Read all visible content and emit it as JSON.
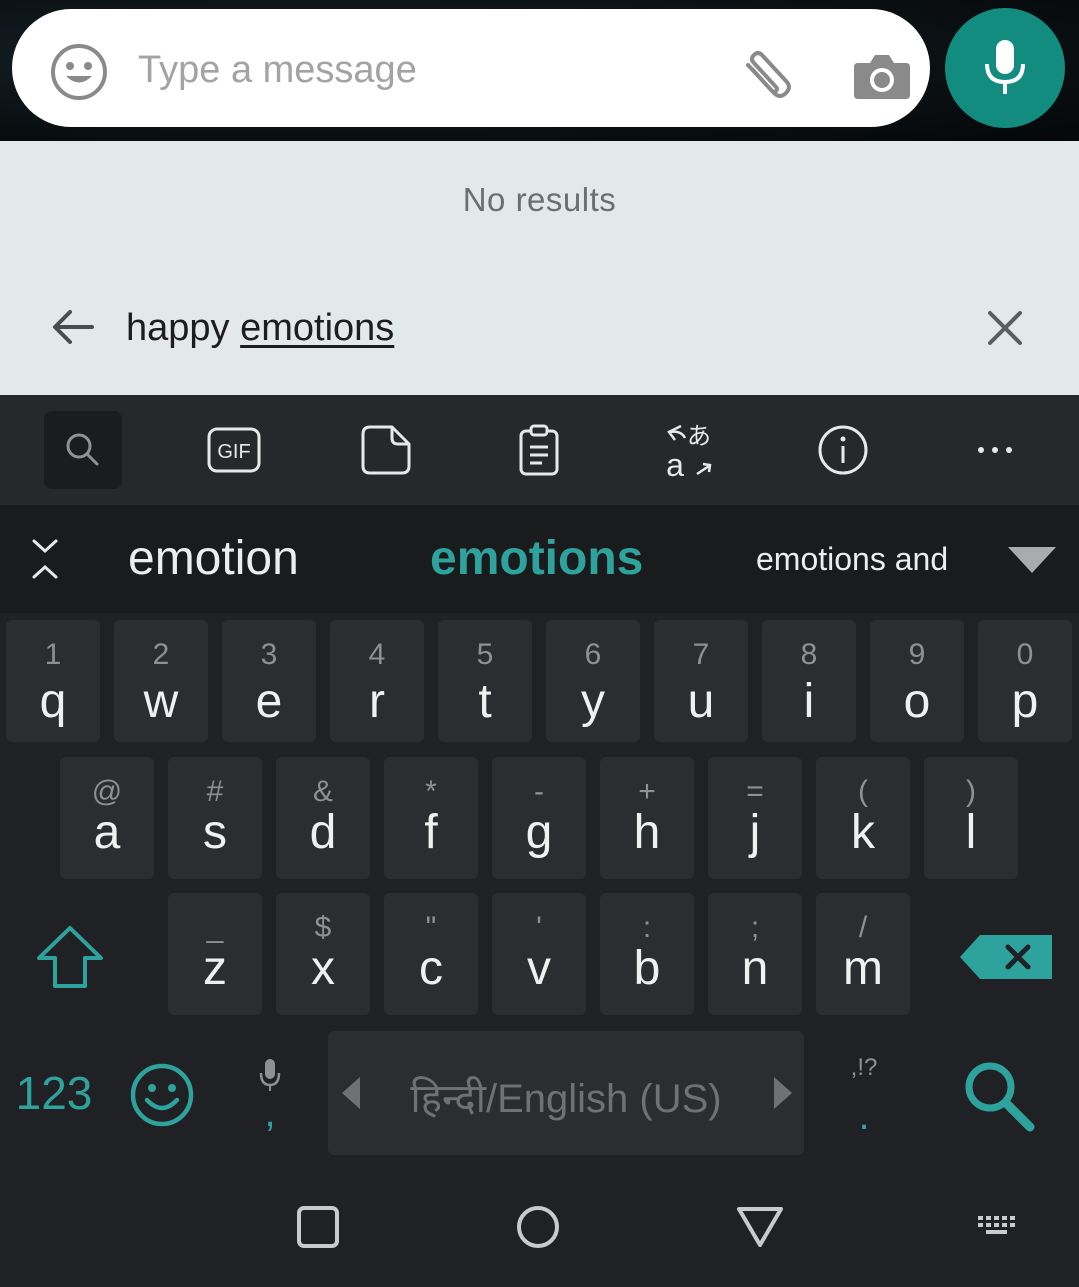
{
  "chat_bar": {
    "placeholder": "Type a message",
    "value": "",
    "icons": [
      "emoji-icon",
      "paperclip-icon",
      "camera-icon",
      "microphone-icon"
    ],
    "accent_color": "#128c7e"
  },
  "search_panel": {
    "status": "No results",
    "query_prefix": "happy ",
    "query_composing": "emotions",
    "icons": [
      "back-arrow-icon",
      "close-icon"
    ]
  },
  "toolbar": {
    "icons": [
      "search-icon",
      "gif-icon",
      "sticker-icon",
      "clipboard-icon",
      "translate-icon",
      "info-icon",
      "more-icon"
    ],
    "gif_label": "GIF"
  },
  "suggestions": {
    "items": [
      "emotion",
      "emotions",
      "emotions and"
    ],
    "highlight_color": "#2ea39d"
  },
  "keyboard": {
    "row1": [
      {
        "hint": "1",
        "key": "q"
      },
      {
        "hint": "2",
        "key": "w"
      },
      {
        "hint": "3",
        "key": "e"
      },
      {
        "hint": "4",
        "key": "r"
      },
      {
        "hint": "5",
        "key": "t"
      },
      {
        "hint": "6",
        "key": "y"
      },
      {
        "hint": "7",
        "key": "u"
      },
      {
        "hint": "8",
        "key": "i"
      },
      {
        "hint": "9",
        "key": "o"
      },
      {
        "hint": "0",
        "key": "p"
      }
    ],
    "row2": [
      {
        "hint": "@",
        "key": "a"
      },
      {
        "hint": "#",
        "key": "s"
      },
      {
        "hint": "&",
        "key": "d"
      },
      {
        "hint": "*",
        "key": "f"
      },
      {
        "hint": "-",
        "key": "g"
      },
      {
        "hint": "+",
        "key": "h"
      },
      {
        "hint": "=",
        "key": "j"
      },
      {
        "hint": "(",
        "key": "k"
      },
      {
        "hint": ")",
        "key": "l"
      }
    ],
    "row3": [
      {
        "hint": "_",
        "key": "z"
      },
      {
        "hint": "$",
        "key": "x"
      },
      {
        "hint": "\"",
        "key": "c"
      },
      {
        "hint": "'",
        "key": "v"
      },
      {
        "hint": ":",
        "key": "b"
      },
      {
        "hint": ";",
        "key": "n"
      },
      {
        "hint": "/",
        "key": "m"
      }
    ],
    "symbols_label": "123",
    "comma": ",",
    "period": ".",
    "period_hint": ",!?",
    "space_label": "हिन्दी/English (US)",
    "accent_color": "#2ea39d"
  },
  "nav_bar": {
    "icons": [
      "recents-icon",
      "home-icon",
      "back-icon",
      "keyboard-switch-icon"
    ]
  }
}
